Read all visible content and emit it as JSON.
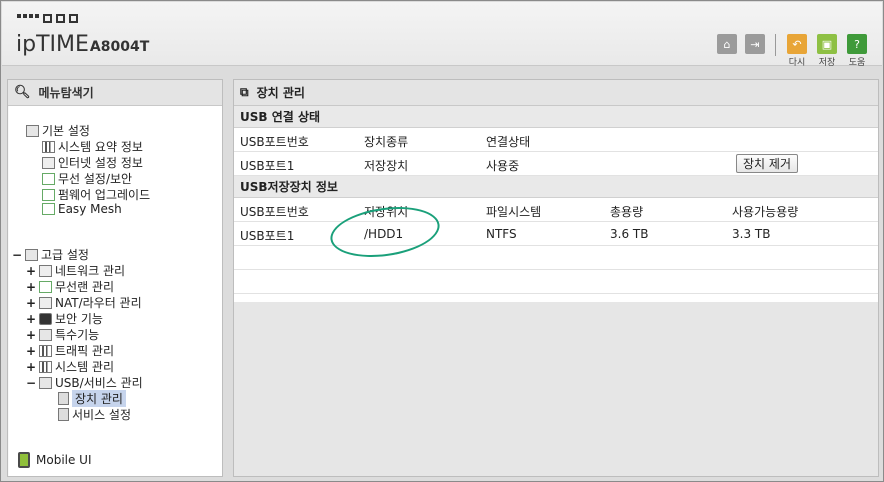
{
  "header": {
    "brand": "ipTIME",
    "model": "A8004T",
    "buttons": [
      {
        "label": "다시",
        "icon": "undo-icon"
      },
      {
        "label": "저장",
        "icon": "save-icon"
      },
      {
        "label": "도움",
        "icon": "help-icon"
      }
    ]
  },
  "left": {
    "title": "메뉴탐색기",
    "basic": {
      "label": "기본 설정",
      "items": [
        "시스템 요약 정보",
        "인터넷 설정 정보",
        "무선 설정/보안",
        "펌웨어 업그레이드",
        "Easy Mesh"
      ]
    },
    "advanced": {
      "label": "고급 설정",
      "items": [
        "네트워크 관리",
        "무선랜 관리",
        "NAT/라우터 관리",
        "보안 기능",
        "특수기능",
        "트래픽 관리",
        "시스템 관리",
        "USB/서비스 관리"
      ],
      "usb_children": [
        "장치 관리",
        "서비스 설정"
      ]
    },
    "mobile_ui": "Mobile UI"
  },
  "main": {
    "title": "장치 관리",
    "usb_status": {
      "section": "USB 연결 상태",
      "headers": [
        "USB포트번호",
        "장치종류",
        "연결상태"
      ],
      "rows": [
        {
          "port": "USB포트1",
          "type": "저장장치",
          "status": "사용중"
        }
      ],
      "remove_button": "장치 제거"
    },
    "storage": {
      "section": "USB저장장치 정보",
      "headers": [
        "USB포트번호",
        "저장위치",
        "파일시스템",
        "총용량",
        "사용가능용량"
      ],
      "rows": [
        {
          "port": "USB포트1",
          "location": "/HDD1",
          "fs": "NTFS",
          "total": "3.6 TB",
          "available": "3.3 TB"
        }
      ]
    }
  },
  "colors": {
    "highlight_ellipse": "#1aa07a",
    "selected_item": "#c6d4ec"
  }
}
